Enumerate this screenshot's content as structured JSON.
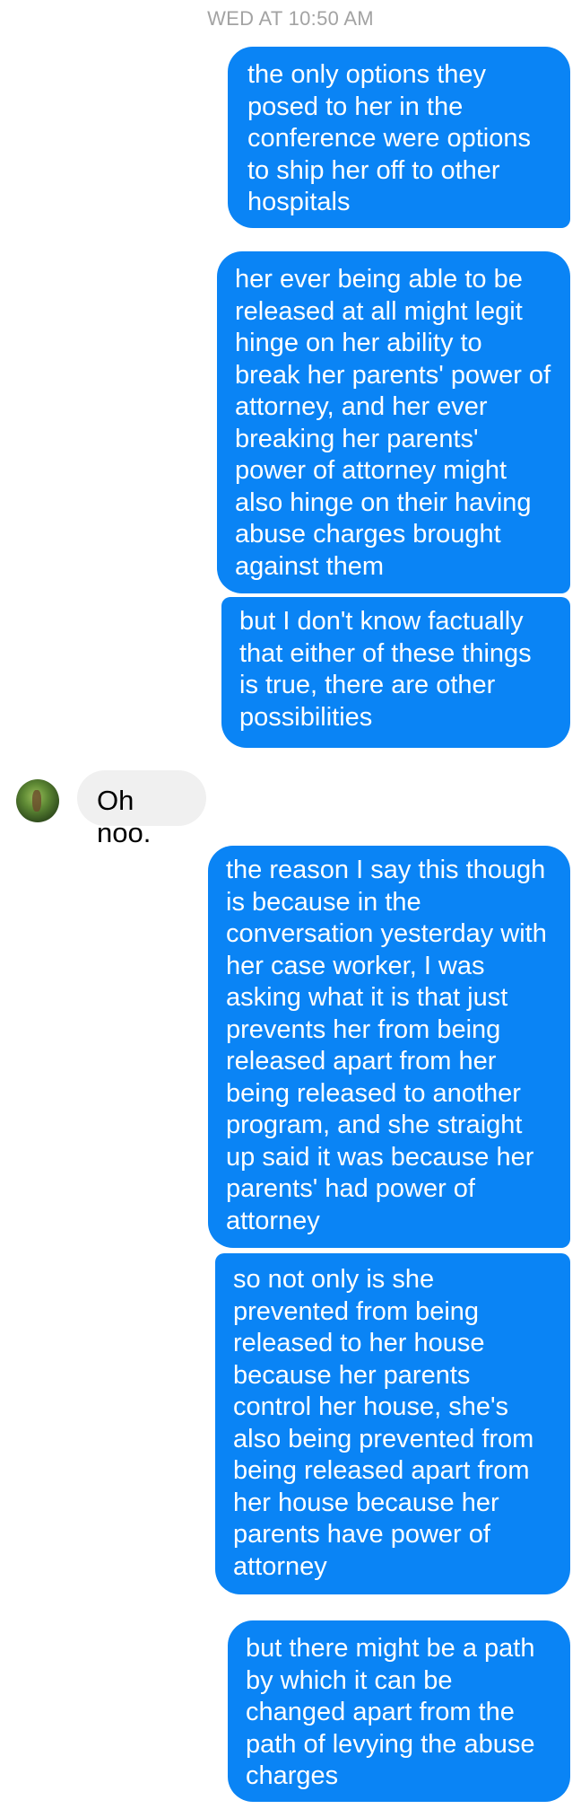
{
  "timestamp": "WED AT 10:50 AM",
  "messages": [
    {
      "sender": "me",
      "text": "the only options they posed to her in the conference were options to ship her off to other hospitals"
    },
    {
      "sender": "me",
      "text": "her ever being able to be released at all might legit hinge on her ability to break her parents' power of attorney, and her ever breaking her parents' power of attorney might also hinge on their having abuse charges brought against them"
    },
    {
      "sender": "me",
      "text": "but I don't know factually that either of these things is true, there are other possibilities"
    },
    {
      "sender": "them",
      "text": "Oh noo."
    },
    {
      "sender": "me",
      "text": "the reason I say this though is because in the conversation yesterday with her case worker, I was asking what it is that just prevents her from being released apart from her being released to another program, and she straight up said it was because her parents' had power of attorney"
    },
    {
      "sender": "me",
      "text": "so not only is she prevented from being released to her house because her parents control her house, she's also being prevented from being released apart from her house because her parents have power of attorney"
    },
    {
      "sender": "me",
      "text": "but there might be a path by which it can be changed apart from the path of levying the abuse charges"
    }
  ],
  "colors": {
    "outgoing_bubble": "#0a84f5",
    "incoming_bubble": "#f0f0f0",
    "timestamp_text": "#a3a3a3"
  },
  "icons": {
    "contact_avatar": "avatar-photo-icon"
  }
}
